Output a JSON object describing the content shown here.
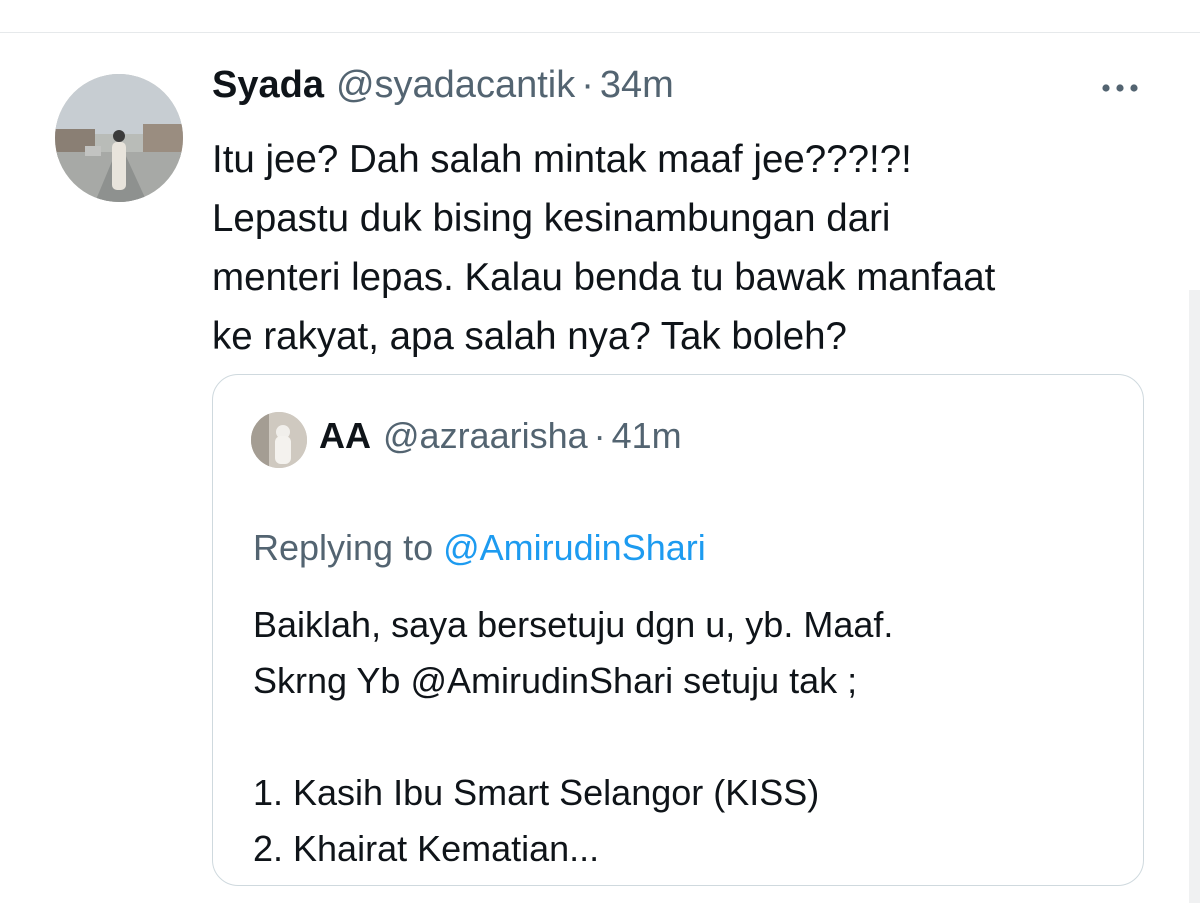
{
  "tweet": {
    "author_name": "Syada",
    "author_handle": "@syadacantik",
    "separator": "·",
    "time": "34m",
    "text": "Itu jee? Dah salah mintak maaf jee???!?!\nLepastu duk bising kesinambungan dari\nmenteri lepas. Kalau benda tu bawak manfaat\nke rakyat, apa salah nya? Tak boleh?",
    "more_icon": "more-dots-icon"
  },
  "quoted_tweet": {
    "author_name": "AA",
    "author_handle": "@azraarisha",
    "separator": "·",
    "time": "41m",
    "replying_prefix": "Replying to ",
    "replying_to": "@AmirudinShari",
    "text_line1": "Baiklah, saya bersetuju dgn u, yb. Maaf.",
    "text_line2_prefix": "Skrng Yb ",
    "text_line2_mention": "@AmirudinShari",
    "text_line2_suffix": " setuju tak ;",
    "list_item_1": "1. Kasih Ibu Smart Selangor (KISS)",
    "list_item_2": "2. Khairat Kematian..."
  },
  "colors": {
    "primary_text": "#0f1419",
    "secondary_text": "#536471",
    "link": "#1d9bf0",
    "border": "#cfd9de"
  }
}
